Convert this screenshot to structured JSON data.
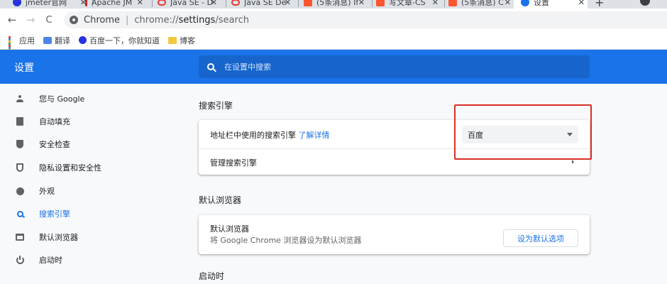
{
  "tabs": [
    {
      "title": "jmeter官网",
      "icon_color": "#2932e1"
    },
    {
      "title": "Apache JM",
      "icon_color": "#c62828"
    },
    {
      "title": "Java SE - D",
      "icon_color": "#e53935"
    },
    {
      "title": "Java SE De",
      "icon_color": "#e53935"
    },
    {
      "title": "(5条消息) If",
      "icon_color": "#fc5531"
    },
    {
      "title": "写文章-CS",
      "icon_color": "#fc5531"
    },
    {
      "title": "(5条消息) C",
      "icon_color": "#fc5531"
    },
    {
      "title": "设置",
      "icon_color": "#1a73e8",
      "active": true
    }
  ],
  "tab_close": "✕",
  "new_tab": "+",
  "toolbar": {
    "back": "←",
    "forward": "→",
    "reload": "C",
    "site_chip": "Chrome",
    "separator": "|",
    "url_prefix": "chrome://",
    "url_host": "settings",
    "url_path": "/search"
  },
  "bookmarks": [
    {
      "label": "应用",
      "icon": "apps-icon"
    },
    {
      "label": "翻译",
      "icon": "translate-icon"
    },
    {
      "label": "百度一下，你就知道",
      "icon": "baidu-paw-icon"
    },
    {
      "label": "博客",
      "icon": "folder-icon"
    }
  ],
  "header": {
    "title": "设置",
    "search_placeholder": "在设置中搜索"
  },
  "sidebar": {
    "items": [
      {
        "label": "您与 Google",
        "icon": "person-icon"
      },
      {
        "label": "自动填充",
        "icon": "clipboard-icon"
      },
      {
        "label": "安全检查",
        "icon": "shield-check-icon"
      },
      {
        "label": "隐私设置和安全性",
        "icon": "privacy-shield-icon"
      },
      {
        "label": "外观",
        "icon": "palette-icon"
      },
      {
        "label": "搜索引擎",
        "icon": "search-icon",
        "active": true
      },
      {
        "label": "默认浏览器",
        "icon": "browser-icon"
      },
      {
        "label": "启动时",
        "icon": "power-icon"
      }
    ]
  },
  "main": {
    "search_engine": {
      "title": "搜索引擎",
      "address_bar_label": "地址栏中使用的搜索引擎",
      "learn_more": "了解详情",
      "selected_engine": "百度",
      "manage_label": "管理搜索引擎"
    },
    "default_browser": {
      "title": "默认浏览器",
      "primary": "默认浏览器",
      "secondary": "将 Google Chrome 浏览器设为默认浏览器",
      "button": "设为默认选项"
    },
    "startup": {
      "title": "启动时"
    }
  },
  "colors": {
    "accent": "#1a73e8",
    "highlight": "#d93025"
  }
}
